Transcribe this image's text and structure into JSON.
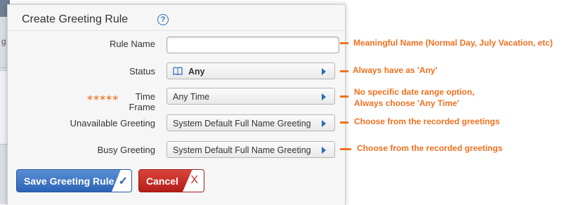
{
  "dialog": {
    "title": "Create Greeting Rule",
    "help_icon": "?"
  },
  "form": {
    "rule_name": {
      "label": "Rule Name",
      "value": ""
    },
    "status": {
      "label": "Status",
      "value": "Any",
      "icon": "book-icon"
    },
    "time_frame": {
      "label": "Time Frame",
      "required_mark": "∗∗∗∗∗",
      "value": "Any Time"
    },
    "unavailable_greeting": {
      "label": "Unavailable Greeting",
      "value": "System Default Full Name Greeting"
    },
    "busy_greeting": {
      "label": "Busy Greeting",
      "value": "System Default Full Name Greeting"
    }
  },
  "buttons": {
    "save_label": "Save Greeting Rule",
    "save_icon": "✓",
    "cancel_label": "Cancel",
    "cancel_icon": "X"
  },
  "annotations": {
    "rule_name": "Meaningful Name (Normal Day, July Vacation, etc)",
    "status": "Always have as 'Any'",
    "time_frame_1": "No specific date range option,",
    "time_frame_2": "Always choose 'Any Time'",
    "unavailable_greeting": "Choose from the recorded greetings",
    "busy_greeting": "Choose from the recorded greetings"
  },
  "colors": {
    "accent_orange": "#f07020",
    "save_blue": "#2c63b5",
    "cancel_red": "#b31e18",
    "arrow_blue": "#2a6ab7"
  }
}
